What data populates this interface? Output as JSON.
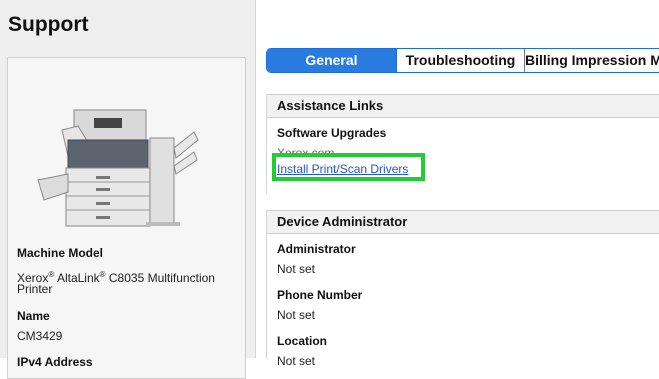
{
  "page": {
    "title": "Support"
  },
  "machine": {
    "model_label": "Machine Model",
    "model_brand": "Xerox",
    "model_sub": "AltaLink",
    "model_name": "C8035 Multifunction",
    "model_name_2": "Printer",
    "reg": "®",
    "name_label": "Name",
    "name_value": "CM3429",
    "ip_label": "IPv4 Address"
  },
  "tabs": [
    {
      "label": "General",
      "active": true
    },
    {
      "label": "Troubleshooting",
      "active": false
    },
    {
      "label": "Billing Impression Meters",
      "active": false
    }
  ],
  "assistance": {
    "heading": "Assistance Links",
    "software_label": "Software Upgrades",
    "software_value": "Xerox.com",
    "driver_link": "Install Print/Scan Drivers"
  },
  "admin": {
    "heading": "Device Administrator",
    "administrator_label": "Administrator",
    "administrator_value": "Not set",
    "phone_label": "Phone Number",
    "phone_value": "Not set",
    "location_label": "Location",
    "location_value": "Not set"
  },
  "colors": {
    "accent": "#2a7be0",
    "highlight": "#22cc33",
    "link": "#2255cc"
  }
}
